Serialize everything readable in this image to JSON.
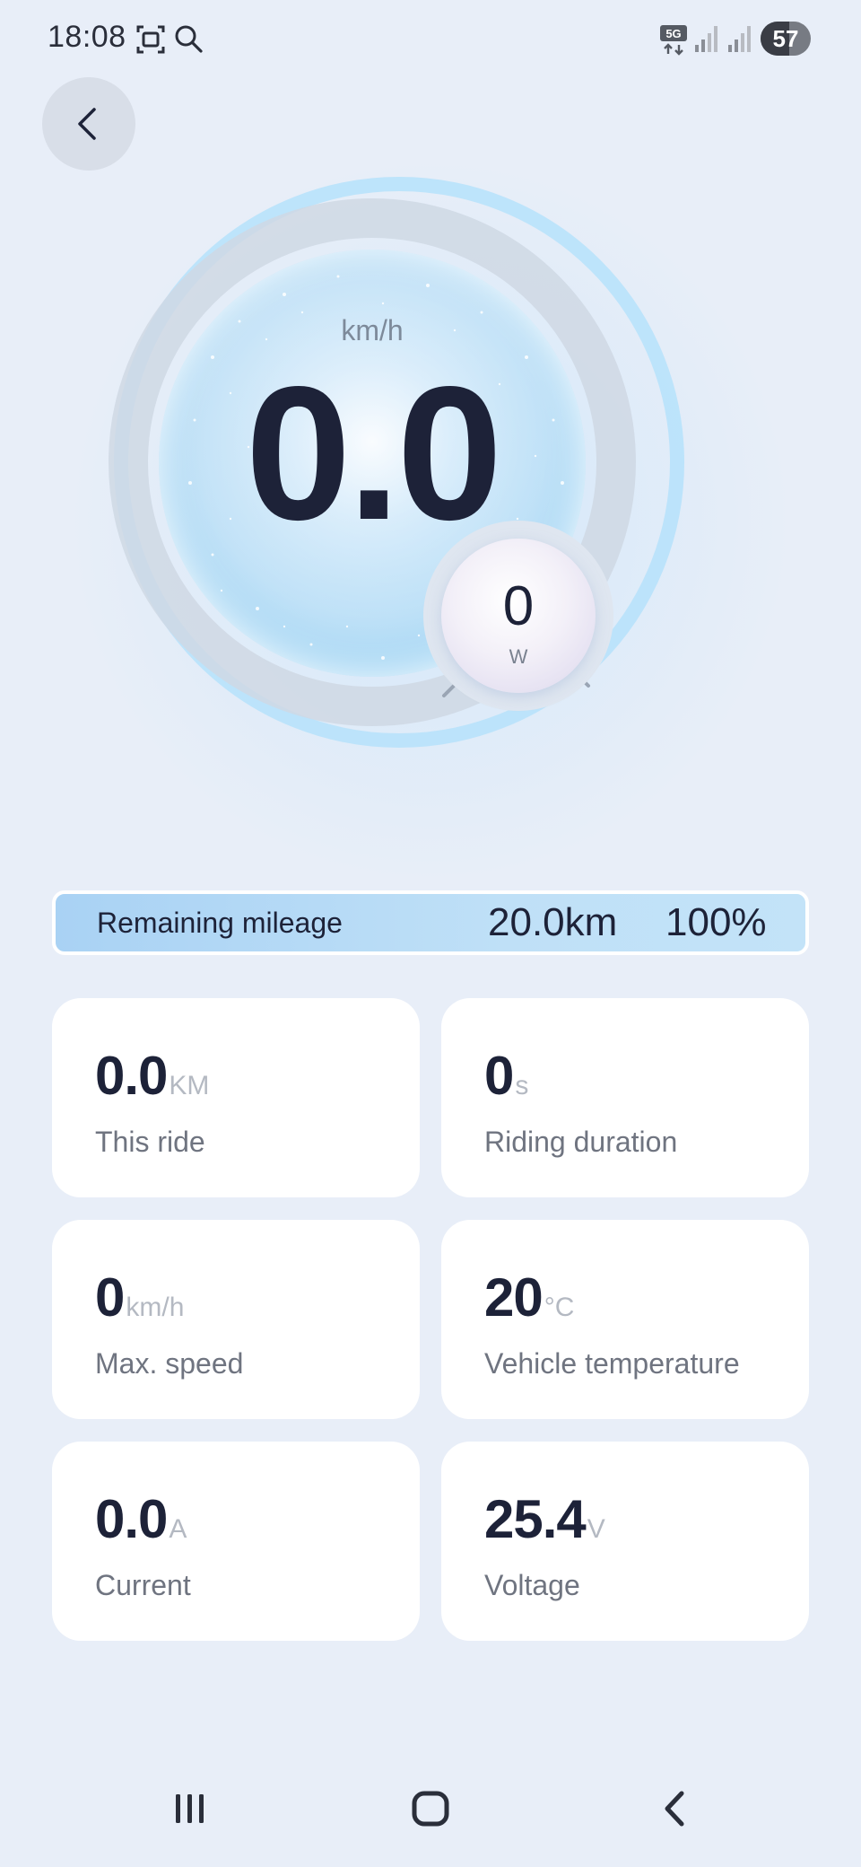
{
  "status_bar": {
    "time": "18:08",
    "icons": [
      "screenshot-icon",
      "search-icon",
      "5g-data-icon",
      "signal-icon",
      "signal-icon"
    ],
    "network_label": "5G",
    "battery_level": "57",
    "battery_fraction": 0.57
  },
  "header": {
    "back_icon": "chevron-left-icon"
  },
  "speedometer": {
    "unit": "km/h",
    "value": "0.0",
    "power_value": "0",
    "power_unit": "W"
  },
  "remaining_mileage": {
    "label": "Remaining mileage",
    "distance": "20.0km",
    "percent": "100%"
  },
  "stats": [
    {
      "value": "0.0",
      "unit": "KM",
      "label": "This ride"
    },
    {
      "value": "0",
      "unit": "s",
      "label": "Riding duration"
    },
    {
      "value": "0",
      "unit": "km/h",
      "label": "Max. speed"
    },
    {
      "value": "20",
      "unit": "°C",
      "label": "Vehicle temperature"
    },
    {
      "value": "0.0",
      "unit": "A",
      "label": "Current"
    },
    {
      "value": "25.4",
      "unit": "V",
      "label": "Voltage"
    }
  ],
  "nav_bar": {
    "icons": [
      "recent-apps-icon",
      "home-icon",
      "back-icon"
    ]
  },
  "colors": {
    "background": "#e8eef8",
    "text_primary": "#1d2238",
    "accent_blue": "#a9d2f4",
    "ring_blue": "#b8e2fb"
  }
}
